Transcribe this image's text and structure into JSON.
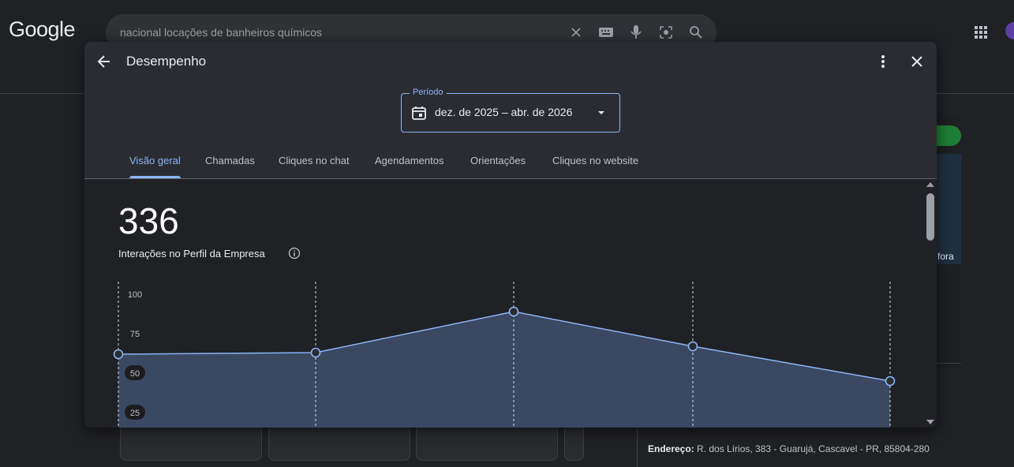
{
  "google": {
    "logo": "Google",
    "search_query": "nacional locações de banheiros químicos"
  },
  "background": {
    "right_panel_text": "fora",
    "address_label": "Endereço:",
    "address_value": "R. dos Lírios, 383 - Guarujá, Cascavel - PR, 85804-280"
  },
  "dialog": {
    "title": "Desempenho",
    "period": {
      "legend": "Período",
      "value": "dez. de 2025 – abr. de 2026"
    },
    "tabs": [
      {
        "label": "Visão geral",
        "active": true
      },
      {
        "label": "Chamadas"
      },
      {
        "label": "Cliques no chat"
      },
      {
        "label": "Agendamentos"
      },
      {
        "label": "Orientações"
      },
      {
        "label": "Cliques no website"
      }
    ],
    "metric": {
      "value": "336",
      "label": "Interações no Perfil da Empresa"
    }
  },
  "chart_data": {
    "type": "area",
    "y_ticks": [
      "100",
      "75",
      "50",
      "25"
    ],
    "ylim": [
      0,
      100
    ],
    "values": [
      62,
      63,
      89,
      67,
      45
    ],
    "line_color": "#8ab4f8",
    "fill_color": "#3b4862"
  }
}
